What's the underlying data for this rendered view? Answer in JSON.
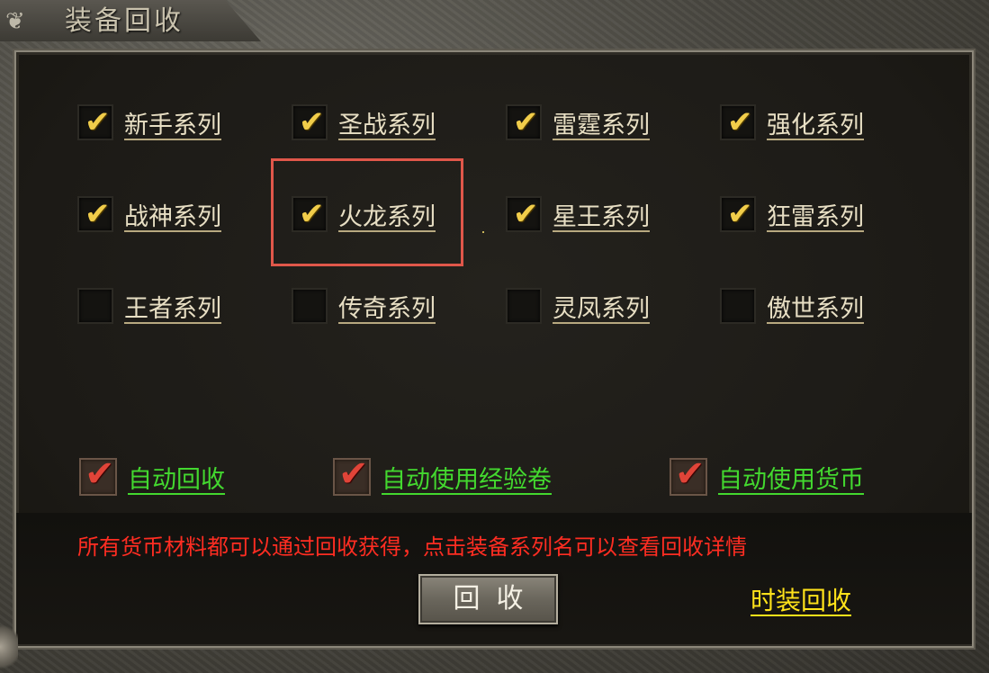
{
  "window": {
    "title": "装备回收"
  },
  "series": [
    {
      "label": "新手系列",
      "checked": true
    },
    {
      "label": "圣战系列",
      "checked": true
    },
    {
      "label": "雷霆系列",
      "checked": true
    },
    {
      "label": "强化系列",
      "checked": true
    },
    {
      "label": "战神系列",
      "checked": true
    },
    {
      "label": "火龙系列",
      "checked": true
    },
    {
      "label": "星王系列",
      "checked": true
    },
    {
      "label": "狂雷系列",
      "checked": true
    },
    {
      "label": "王者系列",
      "checked": false
    },
    {
      "label": "传奇系列",
      "checked": false
    },
    {
      "label": "灵凤系列",
      "checked": false
    },
    {
      "label": "傲世系列",
      "checked": false
    }
  ],
  "auto_options": [
    {
      "label": "自动回收",
      "checked": true
    },
    {
      "label": "自动使用经验卷",
      "checked": true
    },
    {
      "label": "自动使用货币",
      "checked": true
    }
  ],
  "notice": "所有货币材料都可以通过回收获得，点击装备系列名可以查看回收详情",
  "recycle_button": "回收",
  "fashion_recycle_link": "时装回收",
  "check_glyph": "✔",
  "colors": {
    "series_check": "#f1cd4a",
    "auto_check": "#e04438",
    "auto_label": "#43d82f",
    "notice": "#ff2d22",
    "fashion_link": "#ffe21a",
    "highlight": "#e0574a"
  }
}
